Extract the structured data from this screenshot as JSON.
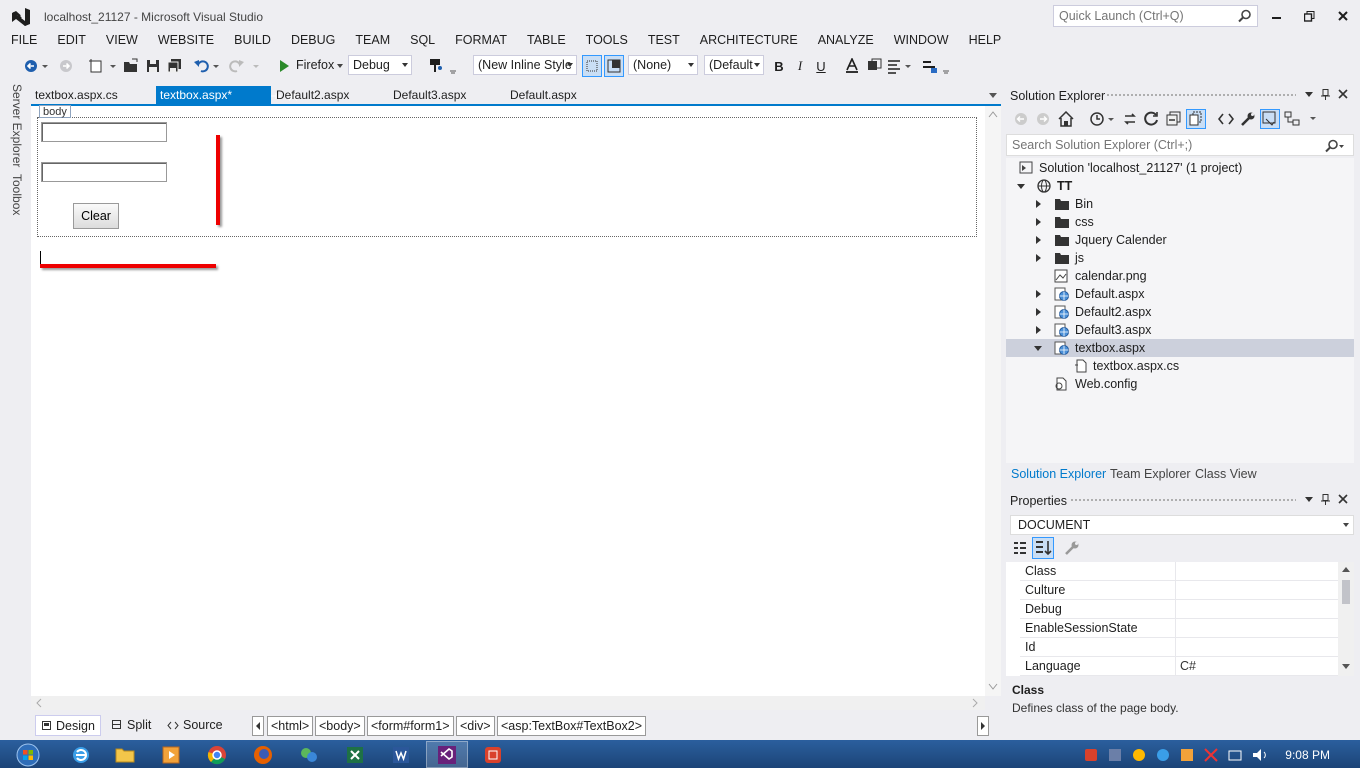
{
  "window": {
    "title": "localhost_21127 - Microsoft Visual Studio",
    "quick_launch_placeholder": "Quick Launch (Ctrl+Q)"
  },
  "menu": [
    "FILE",
    "EDIT",
    "VIEW",
    "WEBSITE",
    "BUILD",
    "DEBUG",
    "TEAM",
    "SQL",
    "FORMAT",
    "TABLE",
    "TOOLS",
    "TEST",
    "ARCHITECTURE",
    "ANALYZE",
    "WINDOW",
    "HELP"
  ],
  "toolbar": {
    "browser": "Firefox",
    "config": "Debug",
    "style_target": "(New Inline Style",
    "class": "(None)",
    "font": "(Default",
    "bold": "B",
    "italic": "I",
    "underline": "U"
  },
  "side_tabs": {
    "server_explorer": "Server Explorer",
    "toolbox": "Toolbox"
  },
  "doc_tabs": [
    "textbox.aspx.cs",
    "textbox.aspx*",
    "Default2.aspx",
    "Default3.aspx",
    "Default.aspx"
  ],
  "designer": {
    "body_tag": "body",
    "clear_button": "Clear"
  },
  "view_bar": {
    "design": "Design",
    "split": "Split",
    "source": "Source",
    "breadcrumbs": [
      "<html>",
      "<body>",
      "<form#form1>",
      "<div>",
      "<asp:TextBox#TextBox2>"
    ]
  },
  "solution_explorer": {
    "title": "Solution Explorer",
    "search_placeholder": "Search Solution Explorer (Ctrl+;)",
    "solution": "Solution 'localhost_21127' (1 project)",
    "project": "TT",
    "items": [
      "Bin",
      "css",
      "Jquery Calender",
      "js",
      "calendar.png",
      "Default.aspx",
      "Default2.aspx",
      "Default3.aspx",
      "textbox.aspx",
      "textbox.aspx.cs",
      "Web.config"
    ],
    "tabs": [
      "Solution Explorer",
      "Team Explorer",
      "Class View"
    ]
  },
  "properties": {
    "title": "Properties",
    "object": "DOCUMENT",
    "rows": [
      {
        "name": "Class",
        "value": ""
      },
      {
        "name": "Culture",
        "value": ""
      },
      {
        "name": "Debug",
        "value": ""
      },
      {
        "name": "EnableSessionState",
        "value": ""
      },
      {
        "name": "Id",
        "value": ""
      },
      {
        "name": "Language",
        "value": "C#"
      }
    ],
    "desc_title": "Class",
    "desc_text": "Defines class of the page body."
  },
  "taskbar": {
    "clock": "9:08 PM"
  }
}
